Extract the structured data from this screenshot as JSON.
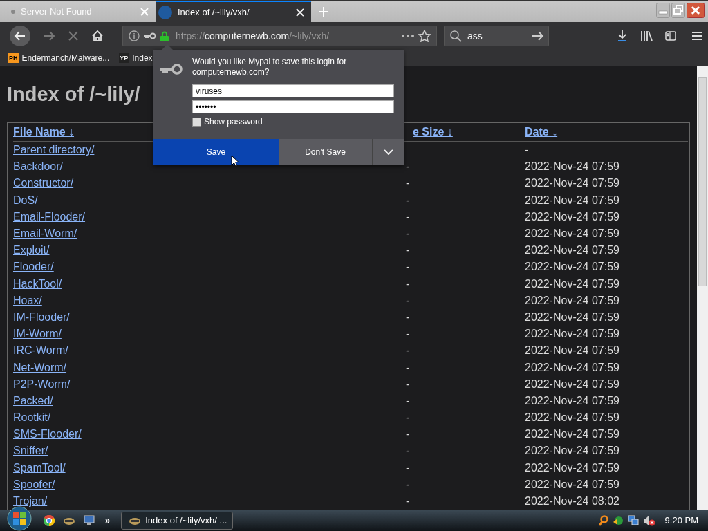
{
  "tabs": [
    {
      "title": "Server Not Found",
      "selected": false
    },
    {
      "title": "Index of /~lily/vxh/",
      "selected": true
    }
  ],
  "address": {
    "scheme": "https://",
    "host": "computernewb.com",
    "path": "/~lily/vxh/"
  },
  "search": {
    "value": "ass"
  },
  "bookmarks": [
    {
      "badge": "PH",
      "label": "Endermanch/Malware..."
    },
    {
      "badge": "YP",
      "label": "Index"
    }
  ],
  "page": {
    "heading": "Index of /~lily/",
    "columns": [
      "File Name ↓",
      "e Size ↓",
      "Date ↓"
    ],
    "rows": [
      {
        "name": "Parent directory/",
        "date": "-"
      },
      {
        "name": "Backdoor/",
        "size": "-",
        "date": "2022-Nov-24 07:59"
      },
      {
        "name": "Constructor/",
        "size": "-",
        "date": "2022-Nov-24 07:59"
      },
      {
        "name": "DoS/",
        "size": "-",
        "date": "2022-Nov-24 07:59"
      },
      {
        "name": "Email-Flooder/",
        "size": "-",
        "date": "2022-Nov-24 07:59"
      },
      {
        "name": "Email-Worm/",
        "size": "-",
        "date": "2022-Nov-24 07:59"
      },
      {
        "name": "Exploit/",
        "size": "-",
        "date": "2022-Nov-24 07:59"
      },
      {
        "name": "Flooder/",
        "size": "-",
        "date": "2022-Nov-24 07:59"
      },
      {
        "name": "HackTool/",
        "size": "-",
        "date": "2022-Nov-24 07:59"
      },
      {
        "name": "Hoax/",
        "size": "-",
        "date": "2022-Nov-24 07:59"
      },
      {
        "name": "IM-Flooder/",
        "size": "-",
        "date": "2022-Nov-24 07:59"
      },
      {
        "name": "IM-Worm/",
        "size": "-",
        "date": "2022-Nov-24 07:59"
      },
      {
        "name": "IRC-Worm/",
        "size": "-",
        "date": "2022-Nov-24 07:59"
      },
      {
        "name": "Net-Worm/",
        "size": "-",
        "date": "2022-Nov-24 07:59"
      },
      {
        "name": "P2P-Worm/",
        "size": "-",
        "date": "2022-Nov-24 07:59"
      },
      {
        "name": "Packed/",
        "size": "-",
        "date": "2022-Nov-24 07:59"
      },
      {
        "name": "Rootkit/",
        "size": "-",
        "date": "2022-Nov-24 07:59"
      },
      {
        "name": "SMS-Flooder/",
        "size": "-",
        "date": "2022-Nov-24 07:59"
      },
      {
        "name": "Sniffer/",
        "size": "-",
        "date": "2022-Nov-24 07:59"
      },
      {
        "name": "SpamTool/",
        "size": "-",
        "date": "2022-Nov-24 07:59"
      },
      {
        "name": "Spoofer/",
        "size": "-",
        "date": "2022-Nov-24 07:59"
      },
      {
        "name": "Trojan/",
        "size": "-",
        "date": "2022-Nov-24 08:02"
      }
    ]
  },
  "login_popup": {
    "message": "Would you like Mypal to save this login for computernewb.com?",
    "username": "viruses",
    "password": "•••••••",
    "show_password": {
      "label": "Show password",
      "checked": false
    },
    "buttons": [
      {
        "label": "Save",
        "kind": "primary"
      },
      {
        "label": "Don’t Save",
        "kind": "secondary"
      }
    ]
  },
  "taskbar": {
    "overflow": "»",
    "task": "Index of /~lily/vxh/ ...",
    "clock": "9:20 PM"
  }
}
